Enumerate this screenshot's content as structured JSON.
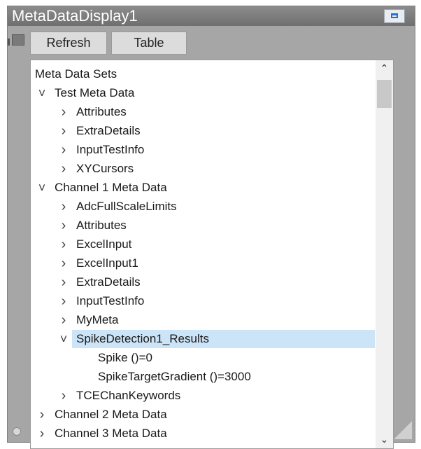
{
  "window": {
    "title": "MetaDataDisplay1"
  },
  "toolbar": {
    "refresh_label": "Refresh",
    "table_label": "Table"
  },
  "tree": {
    "root_label": "Meta Data Sets",
    "rows": [
      {
        "label": "Test Meta Data",
        "level": 0,
        "state": "expanded"
      },
      {
        "label": "Attributes",
        "level": 1,
        "state": "collapsed"
      },
      {
        "label": "ExtraDetails",
        "level": 1,
        "state": "collapsed"
      },
      {
        "label": "InputTestInfo",
        "level": 1,
        "state": "collapsed"
      },
      {
        "label": "XYCursors",
        "level": 1,
        "state": "collapsed"
      },
      {
        "label": "Channel 1 Meta Data",
        "level": 0,
        "state": "expanded"
      },
      {
        "label": "AdcFullScaleLimits",
        "level": 1,
        "state": "collapsed"
      },
      {
        "label": "Attributes",
        "level": 1,
        "state": "collapsed"
      },
      {
        "label": "ExcelInput",
        "level": 1,
        "state": "collapsed"
      },
      {
        "label": "ExcelInput1",
        "level": 1,
        "state": "collapsed"
      },
      {
        "label": "ExtraDetails",
        "level": 1,
        "state": "collapsed"
      },
      {
        "label": "InputTestInfo",
        "level": 1,
        "state": "collapsed"
      },
      {
        "label": "MyMeta",
        "level": 1,
        "state": "collapsed"
      },
      {
        "label": "SpikeDetection1_Results",
        "level": 1,
        "state": "expanded",
        "selected": true
      },
      {
        "label": "Spike ()=0",
        "level": 2,
        "state": "leaf"
      },
      {
        "label": "SpikeTargetGradient ()=3000",
        "level": 2,
        "state": "leaf"
      },
      {
        "label": "TCEChanKeywords",
        "level": 1,
        "state": "collapsed"
      },
      {
        "label": "Channel 2 Meta Data",
        "level": 0,
        "state": "collapsed"
      },
      {
        "label": "Channel 3 Meta Data",
        "level": 0,
        "state": "collapsed"
      }
    ]
  },
  "colors": {
    "selection": "#cce4f7",
    "window_frame": "#a6a6a6",
    "title_bar": "#7f7f7f"
  },
  "icons": {
    "expanded": "chevron-down-icon",
    "collapsed": "chevron-right-icon",
    "restore": "restore-window-icon"
  }
}
